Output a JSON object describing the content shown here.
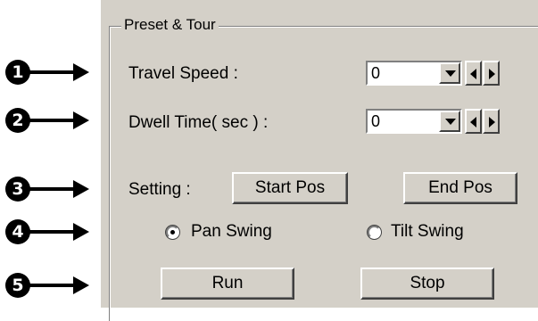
{
  "group_title": "Preset & Tour",
  "callouts": [
    "1",
    "2",
    "3",
    "4",
    "5"
  ],
  "travel_speed": {
    "label": "Travel Speed  :",
    "value": "0"
  },
  "dwell_time": {
    "label": "Dwell Time( sec )  :",
    "value": "0"
  },
  "setting": {
    "label": "Setting  :",
    "start_pos": "Start Pos",
    "end_pos": "End Pos"
  },
  "swing": {
    "pan_label": "Pan Swing",
    "tilt_label": "Tilt Swing",
    "selected": "Pan Swing"
  },
  "actions": {
    "run": "Run",
    "stop": "Stop"
  },
  "icons": {
    "dropdown": "triangle-down-icon",
    "spin_left": "triangle-left-icon",
    "spin_right": "triangle-right-icon",
    "callout_arrow": "arrow-right-icon"
  }
}
